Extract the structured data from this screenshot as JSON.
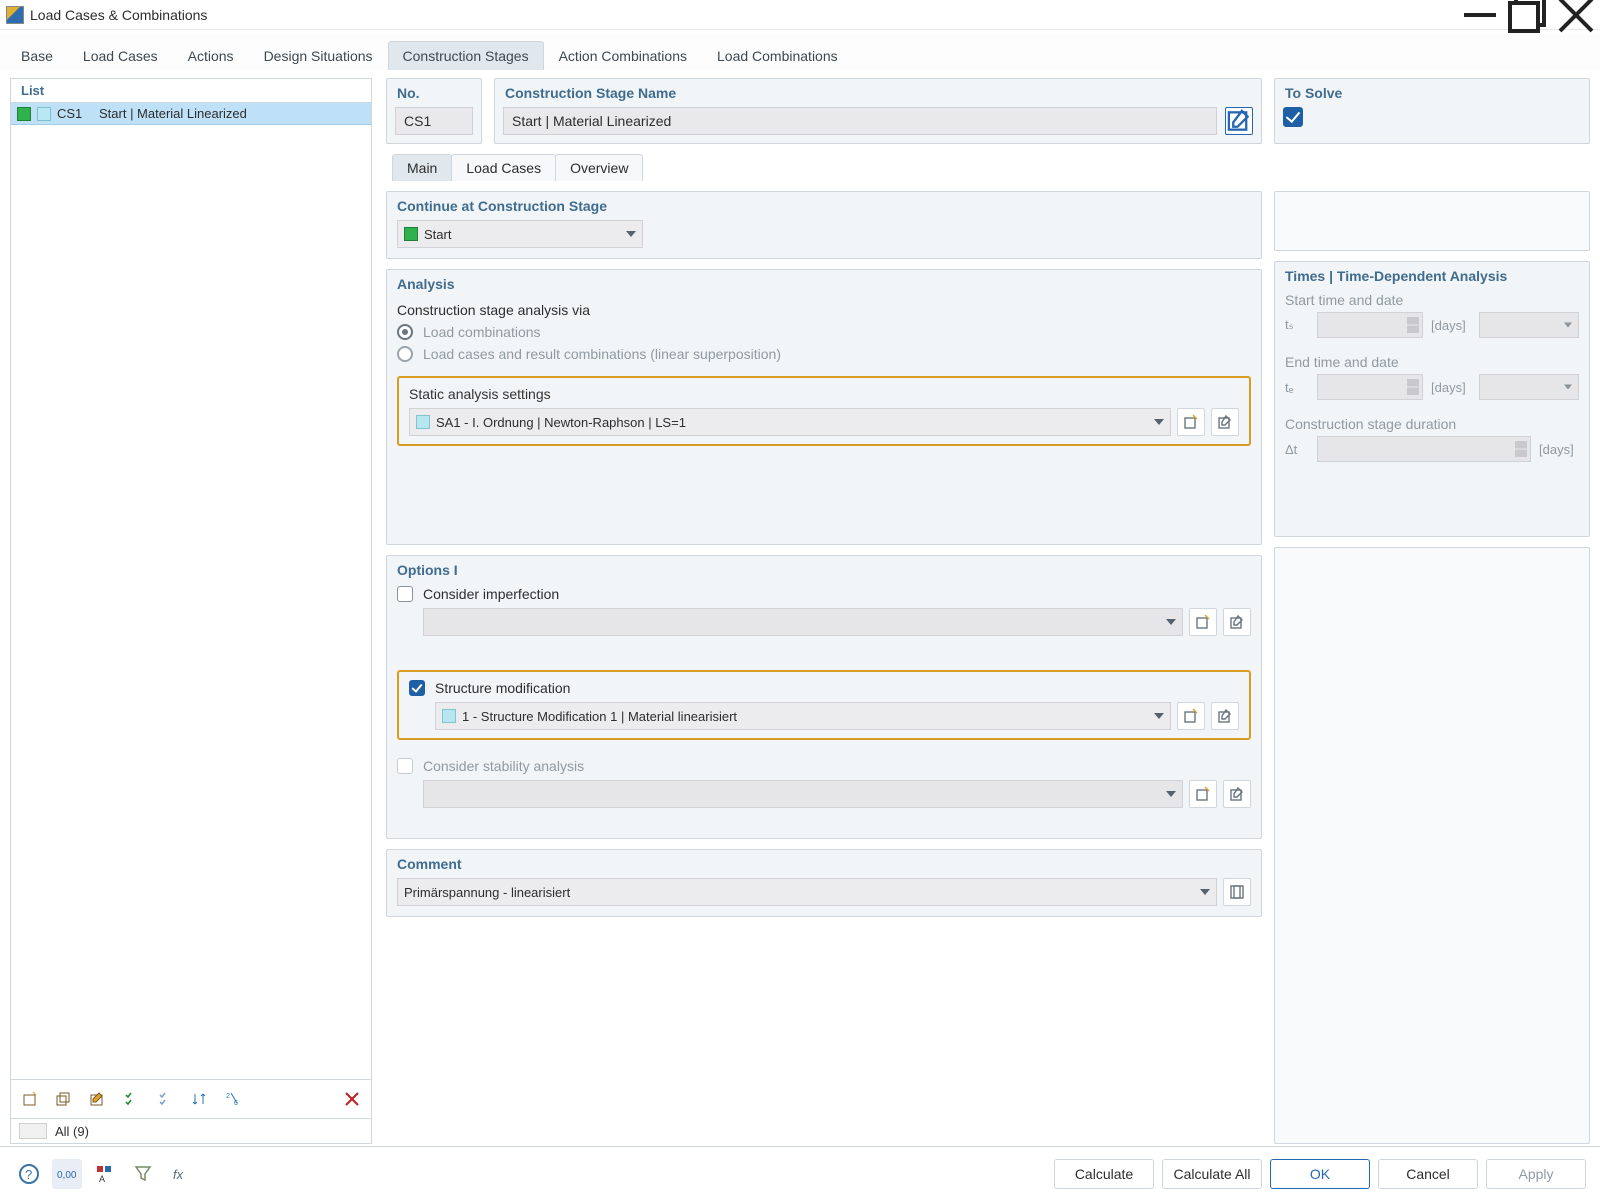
{
  "window": {
    "title": "Load Cases & Combinations"
  },
  "top_tabs": {
    "base": "Base",
    "load_cases": "Load Cases",
    "actions": "Actions",
    "design_situations": "Design Situations",
    "construction_stages": "Construction Stages",
    "action_combinations": "Action Combinations",
    "load_combinations": "Load Combinations",
    "active": "construction_stages"
  },
  "left": {
    "header": "List",
    "row": {
      "id": "CS1",
      "name": "Start | Material Linearized"
    },
    "all_label": "All (9)"
  },
  "head": {
    "no_label": "No.",
    "no_value": "CS1",
    "name_label": "Construction Stage Name",
    "name_value": "Start | Material Linearized",
    "solve_label": "To Solve"
  },
  "sub_tabs": {
    "main": "Main",
    "load_cases": "Load Cases",
    "overview": "Overview"
  },
  "continue": {
    "header": "Continue at Construction Stage",
    "value": "Start"
  },
  "analysis": {
    "header": "Analysis",
    "group_label": "Construction stage analysis via",
    "opt_comb": "Load combinations",
    "opt_linear": "Load cases and result combinations (linear superposition)",
    "static_label": "Static analysis settings",
    "static_value": "SA1 - I. Ordnung | Newton-Raphson | LS=1"
  },
  "times": {
    "header": "Times | Time-Dependent Analysis",
    "start_label": "Start time and date",
    "ts_sym": "tₛ",
    "end_label": "End time and date",
    "te_sym": "tₑ",
    "dur_label": "Construction stage duration",
    "dt_sym": "Δt",
    "unit": "[days]"
  },
  "options": {
    "header": "Options I",
    "imperfection": "Consider imperfection",
    "struct_mod": "Structure modification",
    "struct_mod_value": "1 - Structure Modification 1 | Material linearisiert",
    "stability": "Consider stability analysis"
  },
  "comment": {
    "header": "Comment",
    "value": "Primärspannung - linearisiert"
  },
  "footer": {
    "calculate": "Calculate",
    "calculate_all": "Calculate All",
    "ok": "OK",
    "cancel": "Cancel",
    "apply": "Apply"
  }
}
